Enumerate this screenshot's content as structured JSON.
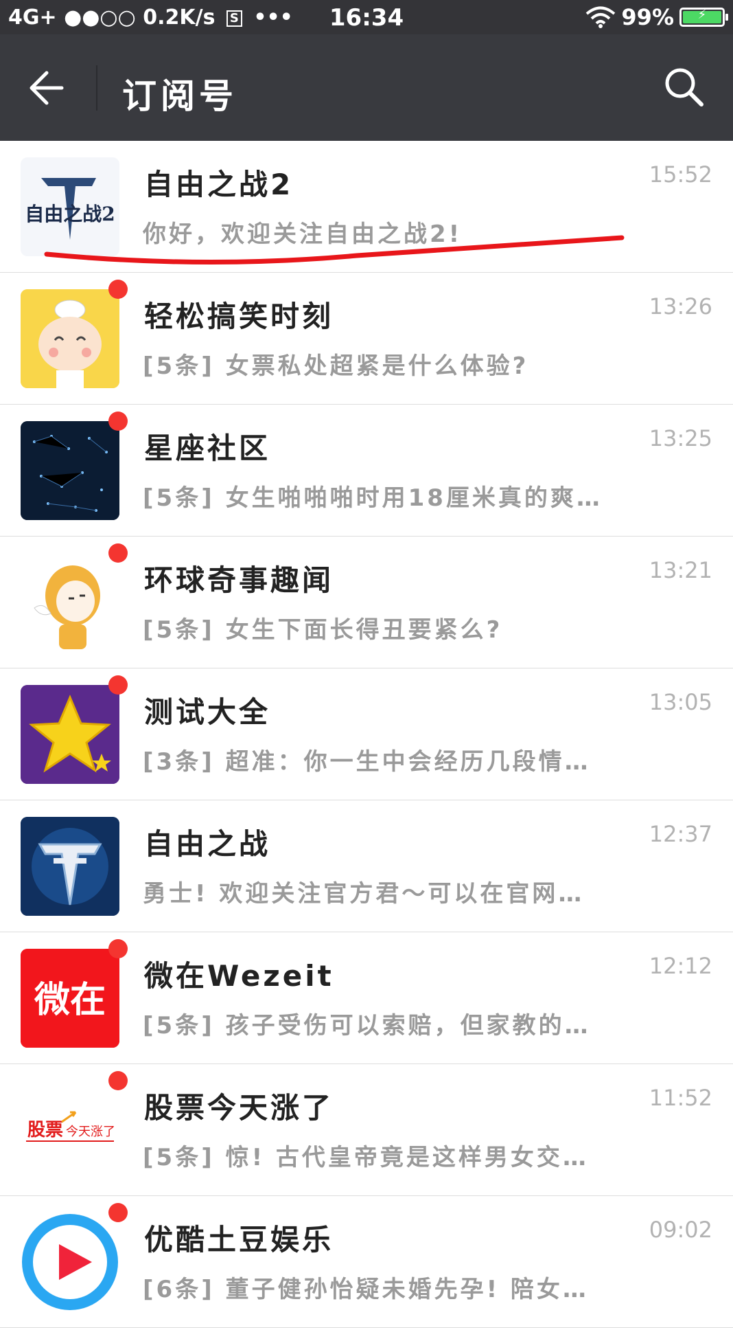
{
  "status_bar": {
    "network": "4G+ ●●○○ 0.2K/s",
    "sim_icon_label": "S",
    "more": "•••",
    "time": "16:34",
    "battery_percent": "99%",
    "battery_level": 0.99
  },
  "header": {
    "title": "订阅号",
    "back_icon": "arrow-left-icon",
    "search_icon": "search-icon"
  },
  "accent_colors": {
    "navbar": "#393a3f",
    "unread_dot": "#f43530",
    "annotation": "#e8161a"
  },
  "items": [
    {
      "name": "自由之战2",
      "time": "15:52",
      "message": "你好，欢迎关注自由之战2!",
      "unread": false
    },
    {
      "name": "轻松搞笑时刻",
      "time": "13:26",
      "message": "[5条] 女票私处超紧是什么体验?",
      "unread": true
    },
    {
      "name": "星座社区",
      "time": "13:25",
      "message": "[5条] 女生啪啪啪时用18厘米真的爽…",
      "unread": true
    },
    {
      "name": "环球奇事趣闻",
      "time": "13:21",
      "message": "[5条] 女生下面长得丑要紧么?",
      "unread": true
    },
    {
      "name": "测试大全",
      "time": "13:05",
      "message": "[3条] 超准：你一生中会经历几段情…",
      "unread": true
    },
    {
      "name": "自由之战",
      "time": "12:37",
      "message": "勇士! 欢迎关注官方君～可以在官网…",
      "unread": false
    },
    {
      "name": "微在Wezeit",
      "time": "12:12",
      "message": "[5条] 孩子受伤可以索赔，但家教的…",
      "unread": true
    },
    {
      "name": "股票今天涨了",
      "time": "11:52",
      "message": "[5条] 惊! 古代皇帝竟是这样男女交…",
      "unread": true
    },
    {
      "name": "优酷土豆娱乐",
      "time": "09:02",
      "message": "[6条] 董子健孙怡疑未婚先孕! 陪女…",
      "unread": true
    }
  ],
  "avatars": {
    "a0_text": "自由之战2",
    "a6_text": "微在",
    "a7_text": "股票",
    "a7_sub": "今天涨了"
  }
}
